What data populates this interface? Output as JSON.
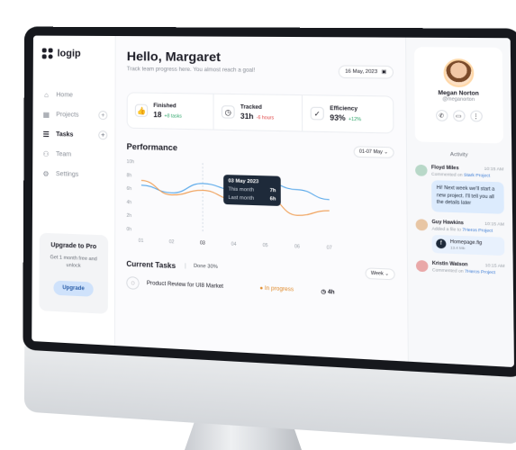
{
  "app": {
    "brand": "logip"
  },
  "sidebar": {
    "items": [
      {
        "label": "Home",
        "icon": "home-icon"
      },
      {
        "label": "Projects",
        "icon": "grid-icon"
      },
      {
        "label": "Tasks",
        "icon": "tasks-icon"
      },
      {
        "label": "Team",
        "icon": "team-icon"
      },
      {
        "label": "Settings",
        "icon": "gear-icon"
      }
    ],
    "upgrade": {
      "title": "Upgrade to Pro",
      "text": "Get 1 month free and unlock",
      "button": "Upgrade"
    }
  },
  "header": {
    "greeting": "Hello, Margaret",
    "subtitle": "Track team progress here. You almost reach a goal!",
    "date": "16 May, 2023"
  },
  "stats": [
    {
      "label": "Finished",
      "value": "18",
      "delta": "+8 tasks",
      "trend": "up",
      "icon": "thumbs-up-icon"
    },
    {
      "label": "Tracked",
      "value": "31h",
      "delta": "-6 hours",
      "trend": "down",
      "icon": "clock-icon"
    },
    {
      "label": "Efficiency",
      "value": "93%",
      "delta": "+12%",
      "trend": "up",
      "icon": "check-icon"
    }
  ],
  "performance": {
    "title": "Performance",
    "range": "01-07 May",
    "tooltip": {
      "date": "03 May 2023",
      "this_label": "This month",
      "this_value": "7h",
      "last_label": "Last month",
      "last_value": "6h"
    }
  },
  "chart_data": {
    "type": "line",
    "x": [
      "01",
      "02",
      "03",
      "04",
      "05",
      "06",
      "07"
    ],
    "y_ticks": [
      "10h",
      "8h",
      "6h",
      "4h",
      "2h",
      "0h"
    ],
    "ylim": [
      0,
      10
    ],
    "series": [
      {
        "name": "This month",
        "color": "#5aa9ea",
        "values": [
          6.5,
          5.5,
          7,
          6.2,
          7.5,
          6.5,
          5.2
        ]
      },
      {
        "name": "Last month",
        "color": "#f0a15a",
        "values": [
          7.2,
          5.2,
          6,
          4.8,
          5.5,
          2.8,
          3.6
        ]
      }
    ]
  },
  "tasks": {
    "title": "Current Tasks",
    "done": "Done 30%",
    "filter": "Week",
    "rows": [
      {
        "name": "Product Review for UI8 Market",
        "status": "In progress",
        "time": "4h"
      }
    ]
  },
  "profile": {
    "name": "Megan Norton",
    "handle": "@meganorton"
  },
  "activity": {
    "title": "Activity",
    "items": [
      {
        "name": "Floyd Miles",
        "time": "10:15 AM",
        "desc_prefix": "Commented on",
        "desc_link": "Stark Project",
        "message": "Hi! Next week we'll start a new project. I'll tell you all the details later"
      },
      {
        "name": "Guy Hawkins",
        "time": "10:15 AM",
        "desc_prefix": "Added a file to",
        "desc_link": "7Heros Project",
        "file_name": "Homepage.fig",
        "file_size": "13.4 Mb"
      },
      {
        "name": "Kristin Watson",
        "time": "10:15 AM",
        "desc_prefix": "Commented on",
        "desc_link": "7Heros Project"
      }
    ]
  }
}
